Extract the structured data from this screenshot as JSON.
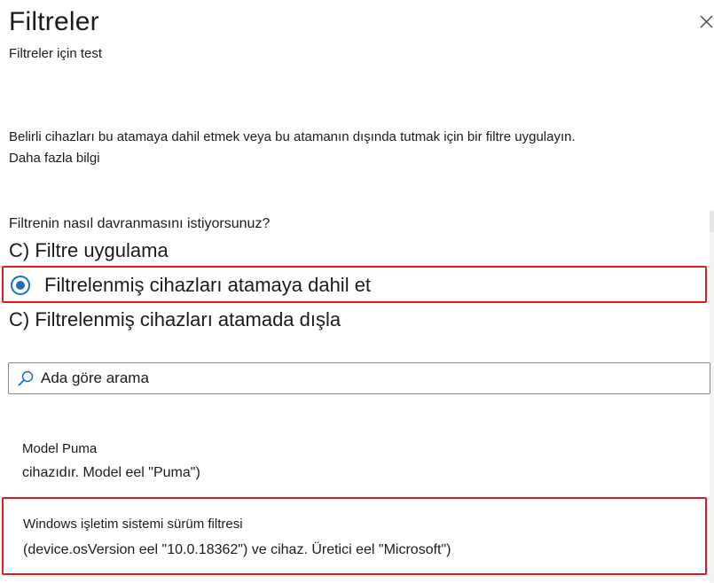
{
  "header": {
    "title": "Filtreler",
    "subtitle": "Filtreler için test",
    "close_icon": "close-icon"
  },
  "intro": {
    "description": "Belirli cihazları bu atamaya dahil etmek veya bu atamanın dışında tutmak için bir filtre uygulayın.",
    "learn_more": "Daha fazla bilgi"
  },
  "behavior": {
    "question": "Filtrenin nasıl davranmasını istiyorsunuz?",
    "options": [
      {
        "label": "C) Filtre uygulama",
        "selected": false
      },
      {
        "label": "Filtrelenmiş cihazları atamaya dahil et",
        "selected": true
      },
      {
        "label": "C) Filtrelenmiş cihazları atamada dışla",
        "selected": false
      }
    ]
  },
  "search": {
    "placeholder": "Ada göre arama",
    "value": "",
    "icon": "search-icon"
  },
  "filters": [
    {
      "name": "Model Puma",
      "rule": "cihazıdır. Model eel \"Puma\")",
      "highlighted": false
    },
    {
      "name": "Windows işletim sistemi sürüm filtresi",
      "rule": "(device.osVersion eel \"10.0.18362\") ve cihaz. Üretici eel \"Microsoft\")",
      "highlighted": true
    }
  ],
  "colors": {
    "accent": "#1b6ec2",
    "highlight_border": "#e01b1b",
    "text": "#1b1b1b"
  }
}
